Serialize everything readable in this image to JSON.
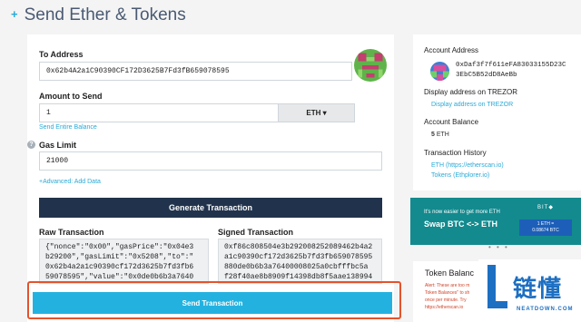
{
  "page": {
    "title": "Send Ether & Tokens",
    "plus": "+"
  },
  "form": {
    "to_address_label": "To Address",
    "to_address_value": "0x62b4A2a1C90390CF172D3625B7Fd3fB659078595",
    "amount_label": "Amount to Send",
    "amount_value": "1",
    "unit_label": "ETH ▾",
    "send_entire_balance": "Send Entire Balance",
    "help_glyph": "?",
    "gas_limit_label": "Gas Limit",
    "gas_limit_value": "21000",
    "advanced_link": "+Advanced: Add Data",
    "generate_button": "Generate Transaction",
    "raw_tx_label": "Raw Transaction",
    "raw_tx_lines": [
      "{\"nonce\":\"0x00\",\"gasPrice\":\"0x04e3",
      "b29200\",\"gasLimit\":\"0x5208\",\"to\":\"",
      "0x62b4a2a1c90390cf172d3625b7fd3fb6",
      "59078595\",\"value\":\"0x0de0b6b3a7640"
    ],
    "signed_tx_label": "Signed Transaction",
    "signed_tx_lines": [
      "0xf86c808504e3b292008252089462b4a2",
      "a1c90390cf172d3625b7fd3fb659078595",
      "880de0b6b3a76400008025a0cbfffbc5a",
      "f28f40ae8b8909f14398db8f5aae138994"
    ],
    "send_button": "Send Transaction"
  },
  "sidebar": {
    "account_address_label": "Account Address",
    "account_address_line1": "0xDaf3f7f611eFA83033155D23C",
    "account_address_line2": "3EbC5B52dD8AeBb",
    "display_trezor_label": "Display address on TREZOR",
    "display_trezor_link": "Display address on TREZOR",
    "balance_label": "Account Balance",
    "balance_amount": "5",
    "balance_unit": "ETH",
    "history_label": "Transaction History",
    "history_eth": "ETH (https://etherscan.io)",
    "history_tokens": "Tokens (Ethplorer.io)"
  },
  "banner": {
    "small_text": "It's now easier to get more ETH",
    "big_text": "Swap BTC <-> ETH",
    "brand": "BIT◆",
    "chip_line1": "1 ETH =",
    "chip_line2": "0.08674 BTC",
    "dots": "• • •"
  },
  "token_balances": {
    "title": "Token Balanc",
    "warning_lines": [
      "Alert: These are too m",
      "Token Balances\" to sh",
      "once per minute. Try",
      "https://etherscan.io"
    ]
  },
  "watermark": {
    "chinese": "链懂",
    "english": "NEATDOWN.COM"
  },
  "colors": {
    "accent": "#23b2e0",
    "navy": "#21334c",
    "highlight": "#e4532c",
    "banner": "#138a8e"
  }
}
